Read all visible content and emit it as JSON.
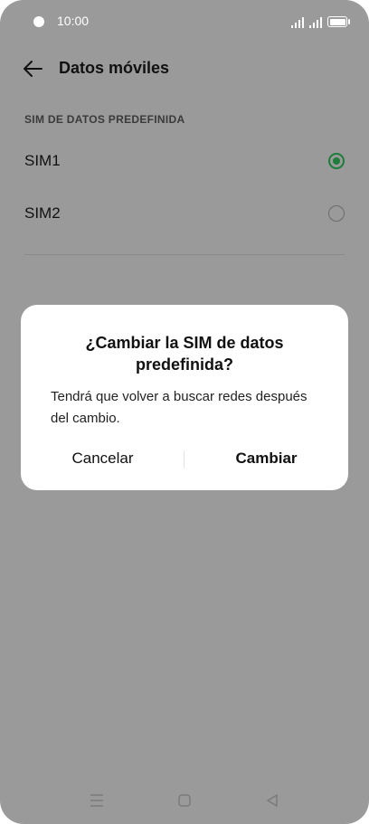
{
  "status_bar": {
    "time": "10:00",
    "icons": [
      "camera-dot",
      "signal-icon",
      "signal-icon",
      "battery-icon"
    ]
  },
  "header": {
    "back_icon": "arrow-left-icon",
    "title": "Datos móviles"
  },
  "sim_section": {
    "label": "SIM DE DATOS PREDEFINIDA",
    "options": [
      {
        "label": "SIM1",
        "selected": true
      },
      {
        "label": "SIM2",
        "selected": false
      }
    ]
  },
  "dialog": {
    "title": "¿Cambiar la SIM de datos predefinida?",
    "message": "Tendrá que volver a buscar redes después del cambio.",
    "cancel_label": "Cancelar",
    "confirm_label": "Cambiar"
  },
  "nav_bar": {
    "icons": [
      "menu-icon",
      "home-icon",
      "back-triangle-icon"
    ]
  },
  "colors": {
    "overlay_background": "#9a9a9a",
    "radio_selected": "#1e7d3c",
    "dialog_background": "#ffffff"
  }
}
